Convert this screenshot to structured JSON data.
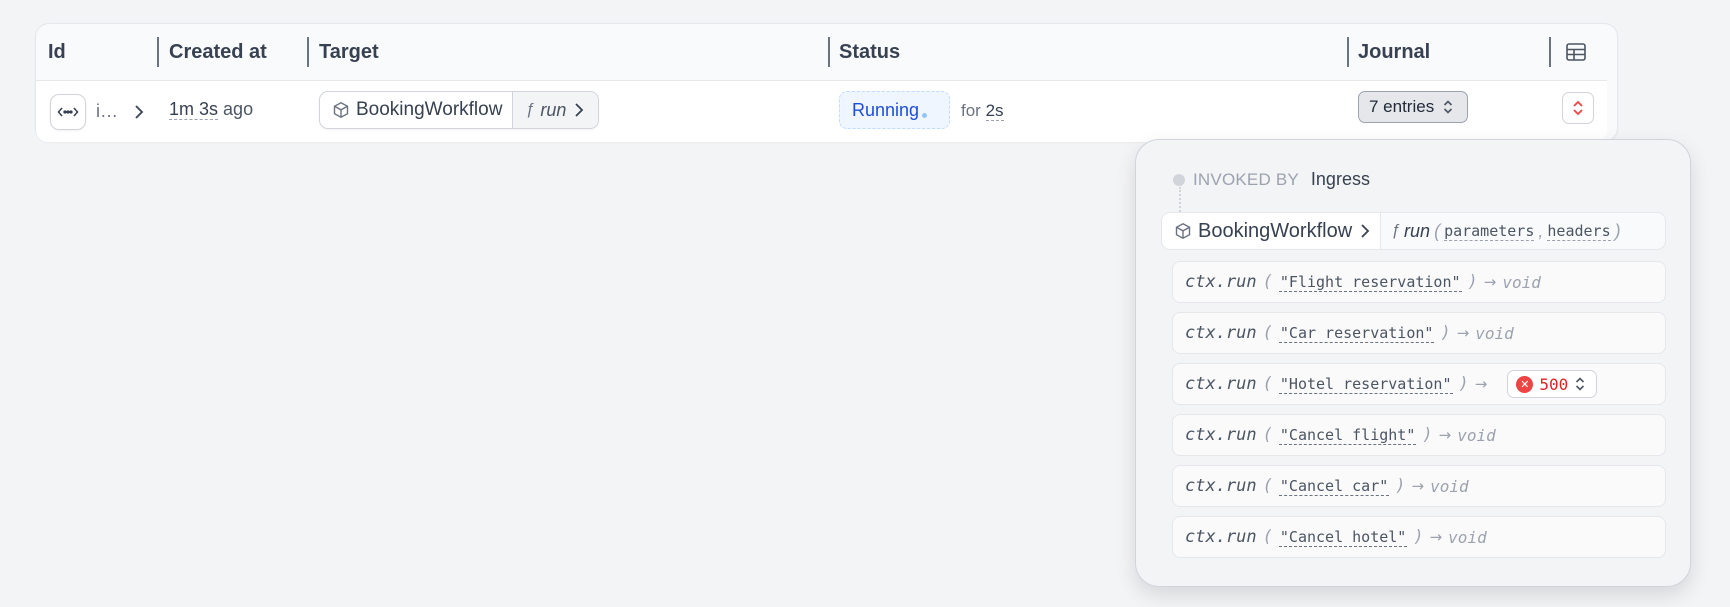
{
  "table": {
    "columns": [
      "Id",
      "Created at",
      "Target",
      "Status",
      "Journal"
    ],
    "row": {
      "id_text": "i…",
      "created": {
        "value": "1m 3s",
        "suffix": "ago"
      },
      "target": {
        "service": "BookingWorkflow",
        "handler": "run"
      },
      "status": {
        "label": "Running",
        "for_prefix": "for",
        "for_value": "2s"
      },
      "journal": {
        "label": "7 entries"
      }
    }
  },
  "popover": {
    "invoked_by_label": "INVOKED BY",
    "invoked_by_value": "Ingress",
    "call": {
      "service": "BookingWorkflow",
      "handler": "run",
      "params": [
        "parameters",
        "headers"
      ]
    },
    "entries": [
      {
        "fn": "ctx.run",
        "arg": "\"Flight reservation\"",
        "result": "void"
      },
      {
        "fn": "ctx.run",
        "arg": "\"Car reservation\"",
        "result": "void"
      },
      {
        "fn": "ctx.run",
        "arg": "\"Hotel reservation\"",
        "error_code": "500"
      },
      {
        "fn": "ctx.run",
        "arg": "\"Cancel flight\"",
        "result": "void"
      },
      {
        "fn": "ctx.run",
        "arg": "\"Cancel car\"",
        "result": "void"
      },
      {
        "fn": "ctx.run",
        "arg": "\"Cancel hotel\"",
        "result": "void"
      }
    ]
  },
  "symbols": {
    "arrow": "→",
    "open_paren": "(",
    "close_paren": ")",
    "comma": ",",
    "function_glyph": "ƒ"
  },
  "colors": {
    "accent": "#1d4ed8",
    "error": "#ef4444"
  },
  "icons": [
    "code-icon",
    "chevron-right-icon",
    "box-icon",
    "function-icon",
    "chevron-updown-icon",
    "table-icon",
    "error-x-icon"
  ]
}
